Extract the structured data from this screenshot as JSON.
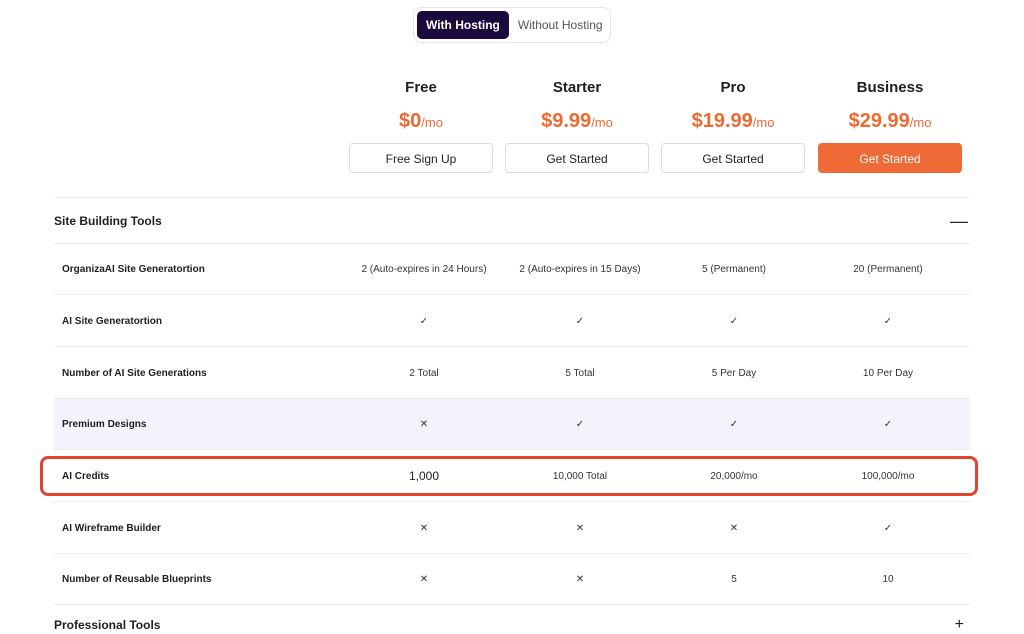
{
  "toggle": {
    "with_hosting": "With Hosting",
    "without_hosting": "Without Hosting"
  },
  "plans": [
    {
      "name": "Free",
      "price": "$0",
      "period": "/mo",
      "button": "Free Sign Up"
    },
    {
      "name": "Starter",
      "price": "$9.99",
      "period": "/mo",
      "button": "Get Started"
    },
    {
      "name": "Pro",
      "price": "$19.99",
      "period": "/mo",
      "button": "Get Started"
    },
    {
      "name": "Business",
      "price": "$29.99",
      "period": "/mo",
      "button": "Get Started"
    }
  ],
  "section": {
    "title": "Site Building Tools",
    "collapse_icon": "minus-icon"
  },
  "rows": [
    {
      "label": "OrganizaAI Site Generatortion",
      "values": [
        "2 (Auto-expires in 24 Hours)",
        "2 (Auto-expires in 15 Days)",
        "5 (Permanent)",
        "20 (Permanent)"
      ]
    },
    {
      "label": "AI Site Generatortion",
      "values": [
        "✓",
        "✓",
        "✓",
        "✓"
      ]
    },
    {
      "label": "Number of AI Site Generations",
      "values": [
        "2 Total",
        "5 Total",
        "5 Per Day",
        "10 Per Day"
      ]
    },
    {
      "label": "Premium Designs",
      "values": [
        "✕",
        "✓",
        "✓",
        "✓"
      ]
    },
    {
      "label": "AI Credits",
      "values": [
        "1,000",
        "10,000 Total",
        "20,000/mo",
        "100,000/mo"
      ]
    },
    {
      "label": "AI Wireframe Builder",
      "values": [
        "✕",
        "✕",
        "✕",
        "✓"
      ]
    },
    {
      "label": "Number of Reusable Blueprints",
      "values": [
        "✕",
        "✕",
        "5",
        "10"
      ]
    }
  ],
  "next_section": {
    "title": "Professional Tools",
    "expand_icon": "+"
  },
  "colors": {
    "accent": "#ef6a36",
    "toggle_active": "#1a0a3d",
    "check": "#3c9a4e",
    "cross": "#e0483a",
    "highlight": "#e2432f"
  }
}
